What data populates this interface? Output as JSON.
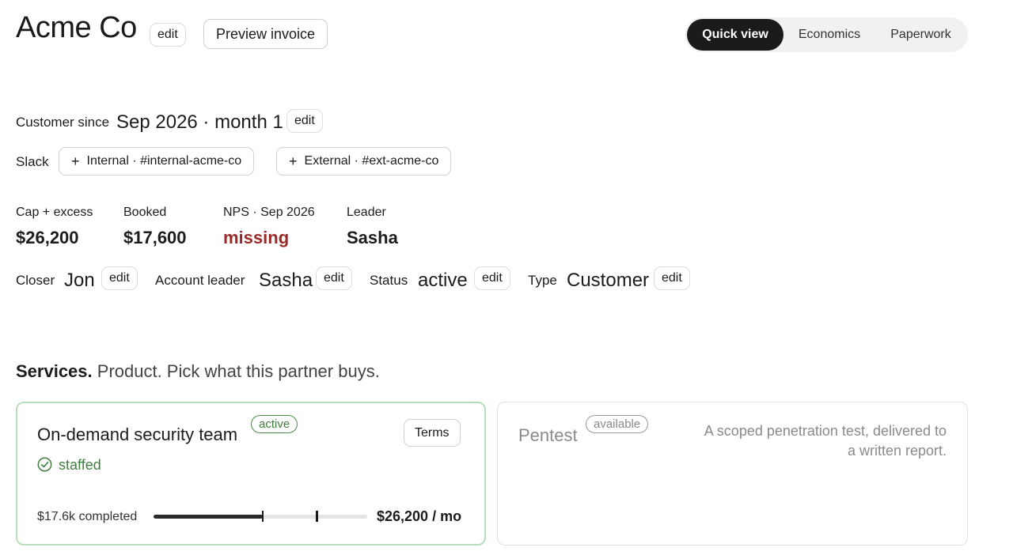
{
  "header": {
    "title": "Acme Co",
    "title_edit": "edit",
    "preview_button": "Preview invoice",
    "tabs": [
      {
        "label": "Quick view",
        "active": true
      },
      {
        "label": "Economics",
        "active": false
      },
      {
        "label": "Paperwork",
        "active": false
      }
    ]
  },
  "customer_since": {
    "label": "Customer since",
    "value": "Sep 2026 · month 1",
    "edit": "edit"
  },
  "slack": {
    "label": "Slack",
    "channels": [
      {
        "label": "Internal · #internal-acme-co",
        "icon": "plus-icon"
      },
      {
        "label": "External · #ext-acme-co",
        "icon": "plus-icon"
      }
    ]
  },
  "stats": [
    {
      "label": "Cap + excess",
      "value": "$26,200"
    },
    {
      "label": "Booked",
      "value": "$17,600"
    },
    {
      "label": "NPS · Sep 2026",
      "value": "missing",
      "color": "#9a2a2a"
    },
    {
      "label": "Leader",
      "value": "Sasha"
    }
  ],
  "fields": [
    {
      "label": "Closer",
      "value": "Jon",
      "edit": "edit"
    },
    {
      "label": "Account leader",
      "value": "Sasha",
      "edit": "edit"
    },
    {
      "label": "Status",
      "value": "active",
      "edit": "edit"
    },
    {
      "label": "Type",
      "value": "Customer",
      "edit": "edit"
    }
  ],
  "services": {
    "heading": "Services.",
    "subheading": "Product. Pick what this partner buys.",
    "cards": [
      {
        "name": "On-demand security team",
        "badge": "active",
        "terms_button": "Terms",
        "status": "staffed",
        "status_icon": "check-circle-icon",
        "completed": "$17.6k completed",
        "price": "$26,200 / mo",
        "progress_fraction": 0.51,
        "marker_fraction": 0.76,
        "accent": "#b8deb9"
      },
      {
        "name": "Pentest",
        "badge": "available",
        "description": "A scoped penetration test, delivered to a written report."
      }
    ]
  }
}
